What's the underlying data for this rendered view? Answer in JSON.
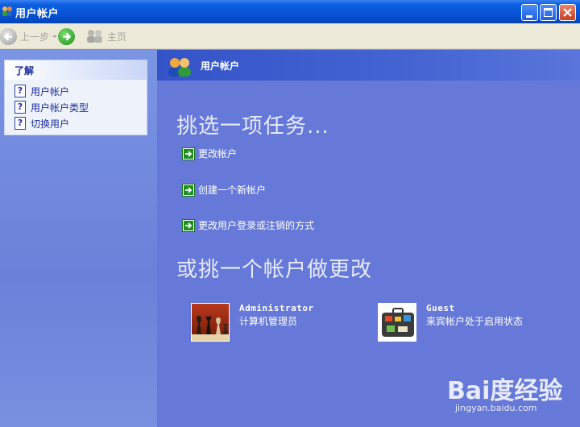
{
  "window": {
    "title": "用户帐户"
  },
  "toolbar": {
    "back_label": "上一步",
    "home_label": "主页"
  },
  "left_panel": {
    "heading": "了解",
    "items": [
      {
        "label": "用户帐户"
      },
      {
        "label": "用户帐户类型"
      },
      {
        "label": "切换用户"
      }
    ]
  },
  "main": {
    "header_title": "用户帐户",
    "task_heading": "挑选一项任务...",
    "tasks": [
      {
        "label": "更改帐户"
      },
      {
        "label": "创建一个新帐户"
      },
      {
        "label": "更改用户登录或注销的方式"
      }
    ],
    "account_heading": "或挑一个帐户做更改",
    "accounts": [
      {
        "name": "Administrator",
        "description": "计算机管理员",
        "picture": "chess-picture"
      },
      {
        "name": "Guest",
        "description": "来宾帐户处于启用状态",
        "picture": "suitcase-picture"
      }
    ]
  },
  "watermark": {
    "logo": "Bai度经验",
    "url": "jingyan.baidu.com"
  },
  "colors": {
    "title_bar": "#0753d6",
    "main_bg": "#6679d8",
    "left_pane": "#7b95e4",
    "toolbar": "#ece9d8",
    "task_arrow": "#1d8f1d"
  }
}
